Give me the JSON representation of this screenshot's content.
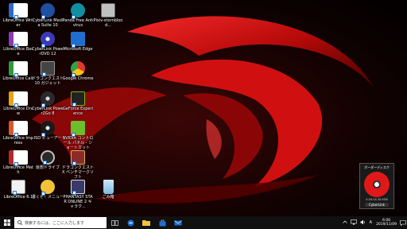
{
  "desktop": {
    "icons": [
      {
        "label": "LibreOffice Writer",
        "icon": "writer-icon",
        "color": "#2a6ac7"
      },
      {
        "label": "LibreOffice Base",
        "icon": "base-icon",
        "color": "#8a3ab8"
      },
      {
        "label": "LibreOffice Calc",
        "icon": "calc-icon",
        "color": "#2f9a3a"
      },
      {
        "label": "LibreOffice Draw",
        "icon": "draw-icon",
        "color": "#e8a21a"
      },
      {
        "label": "LibreOffice Impress",
        "icon": "impress-icon",
        "color": "#d5582a"
      },
      {
        "label": "LibreOffice Math",
        "icon": "math-icon",
        "color": "#b02a2a"
      },
      {
        "label": "LibreOffice 6.1",
        "icon": "libreoffice-icon",
        "color": "#f2f2f2"
      },
      {
        "label": "CyberLink Media Suite 10",
        "icon": "cyberlink-media-suite-icon",
        "color": "#1e4fa0"
      },
      {
        "label": "CyberLink PowerDVD 12",
        "icon": "powerdvd-icon",
        "color": "#3a3ab8"
      },
      {
        "label": "ドラゴンクエスト10 ガジェット",
        "icon": "dragon-quest-gadget-icon",
        "color": "#444"
      },
      {
        "label": "CyberLink Power2Go 8",
        "icon": "power2go-icon",
        "color": "#2a2a2a"
      },
      {
        "label": "ISO ビューアー",
        "icon": "iso-viewer-icon",
        "color": "#1a1a1a"
      },
      {
        "label": "仮想ドライブ",
        "icon": "virtual-drive-icon",
        "color": "#2a2a2a"
      },
      {
        "label": "書くぞ！メニュー",
        "icon": "write-menu-icon",
        "color": "#f2c23a"
      },
      {
        "label": "Panda Free Antivirus",
        "icon": "panda-antivirus-icon",
        "color": "#0f8f9f"
      },
      {
        "label": "Microsoft Edge",
        "icon": "edge-icon",
        "color": "#1f6fd0"
      },
      {
        "label": "Google Chrome",
        "icon": "chrome-icon",
        "color": "#e23a2a"
      },
      {
        "label": "GeForce Experience",
        "icon": "geforce-experience-icon",
        "color": "#222"
      },
      {
        "label": "NVIDIA コントロール パネル - ショートカット",
        "icon": "nvidia-control-panel-icon",
        "color": "#6abf2a"
      },
      {
        "label": "ドラゴンクエストX ベンチマークソフト",
        "icon": "dqx-benchmark-icon",
        "color": "#8a2a2a"
      },
      {
        "label": "PHANTASY STAR ONLINE 2 キャラク...",
        "icon": "pso2-icon",
        "color": "#3a3a6a"
      },
      {
        "label": "Pixiv-stornblood...",
        "icon": "pixiv-icon",
        "color": "#c0c0c0"
      },
      {
        "label": "ごみ箱",
        "icon": "recycle-bin-icon",
        "color": "#9fcff0"
      }
    ]
  },
  "gadget": {
    "title": "ボーダーディスク",
    "info": "0:20:14 20.5GB",
    "brand": "CyberLink"
  },
  "taskbar": {
    "search_placeholder": "検索するには、ここに入力します",
    "time": "6:06",
    "date": "2019/11/09",
    "ime": "A"
  }
}
